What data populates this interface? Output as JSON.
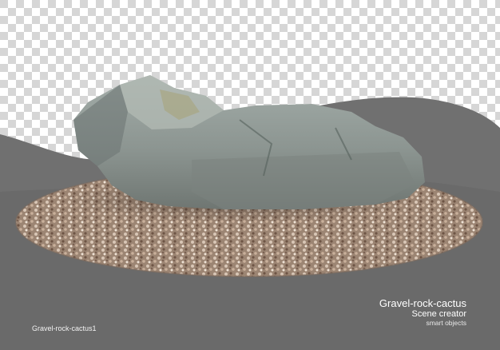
{
  "scene": {
    "title": "Gravel-rock-cactus",
    "subtitle": "Scene creator",
    "tag": "smart objects",
    "file_label": "Gravel-rock-cactus1"
  },
  "colors": {
    "backdrop_gray": "#707070",
    "mid_gray": "#5a5a5a",
    "checker_light": "#ffffff",
    "checker_dark": "#d6d6d6",
    "gravel_base": "#a68f7c",
    "rock_base": "#8f9796"
  }
}
